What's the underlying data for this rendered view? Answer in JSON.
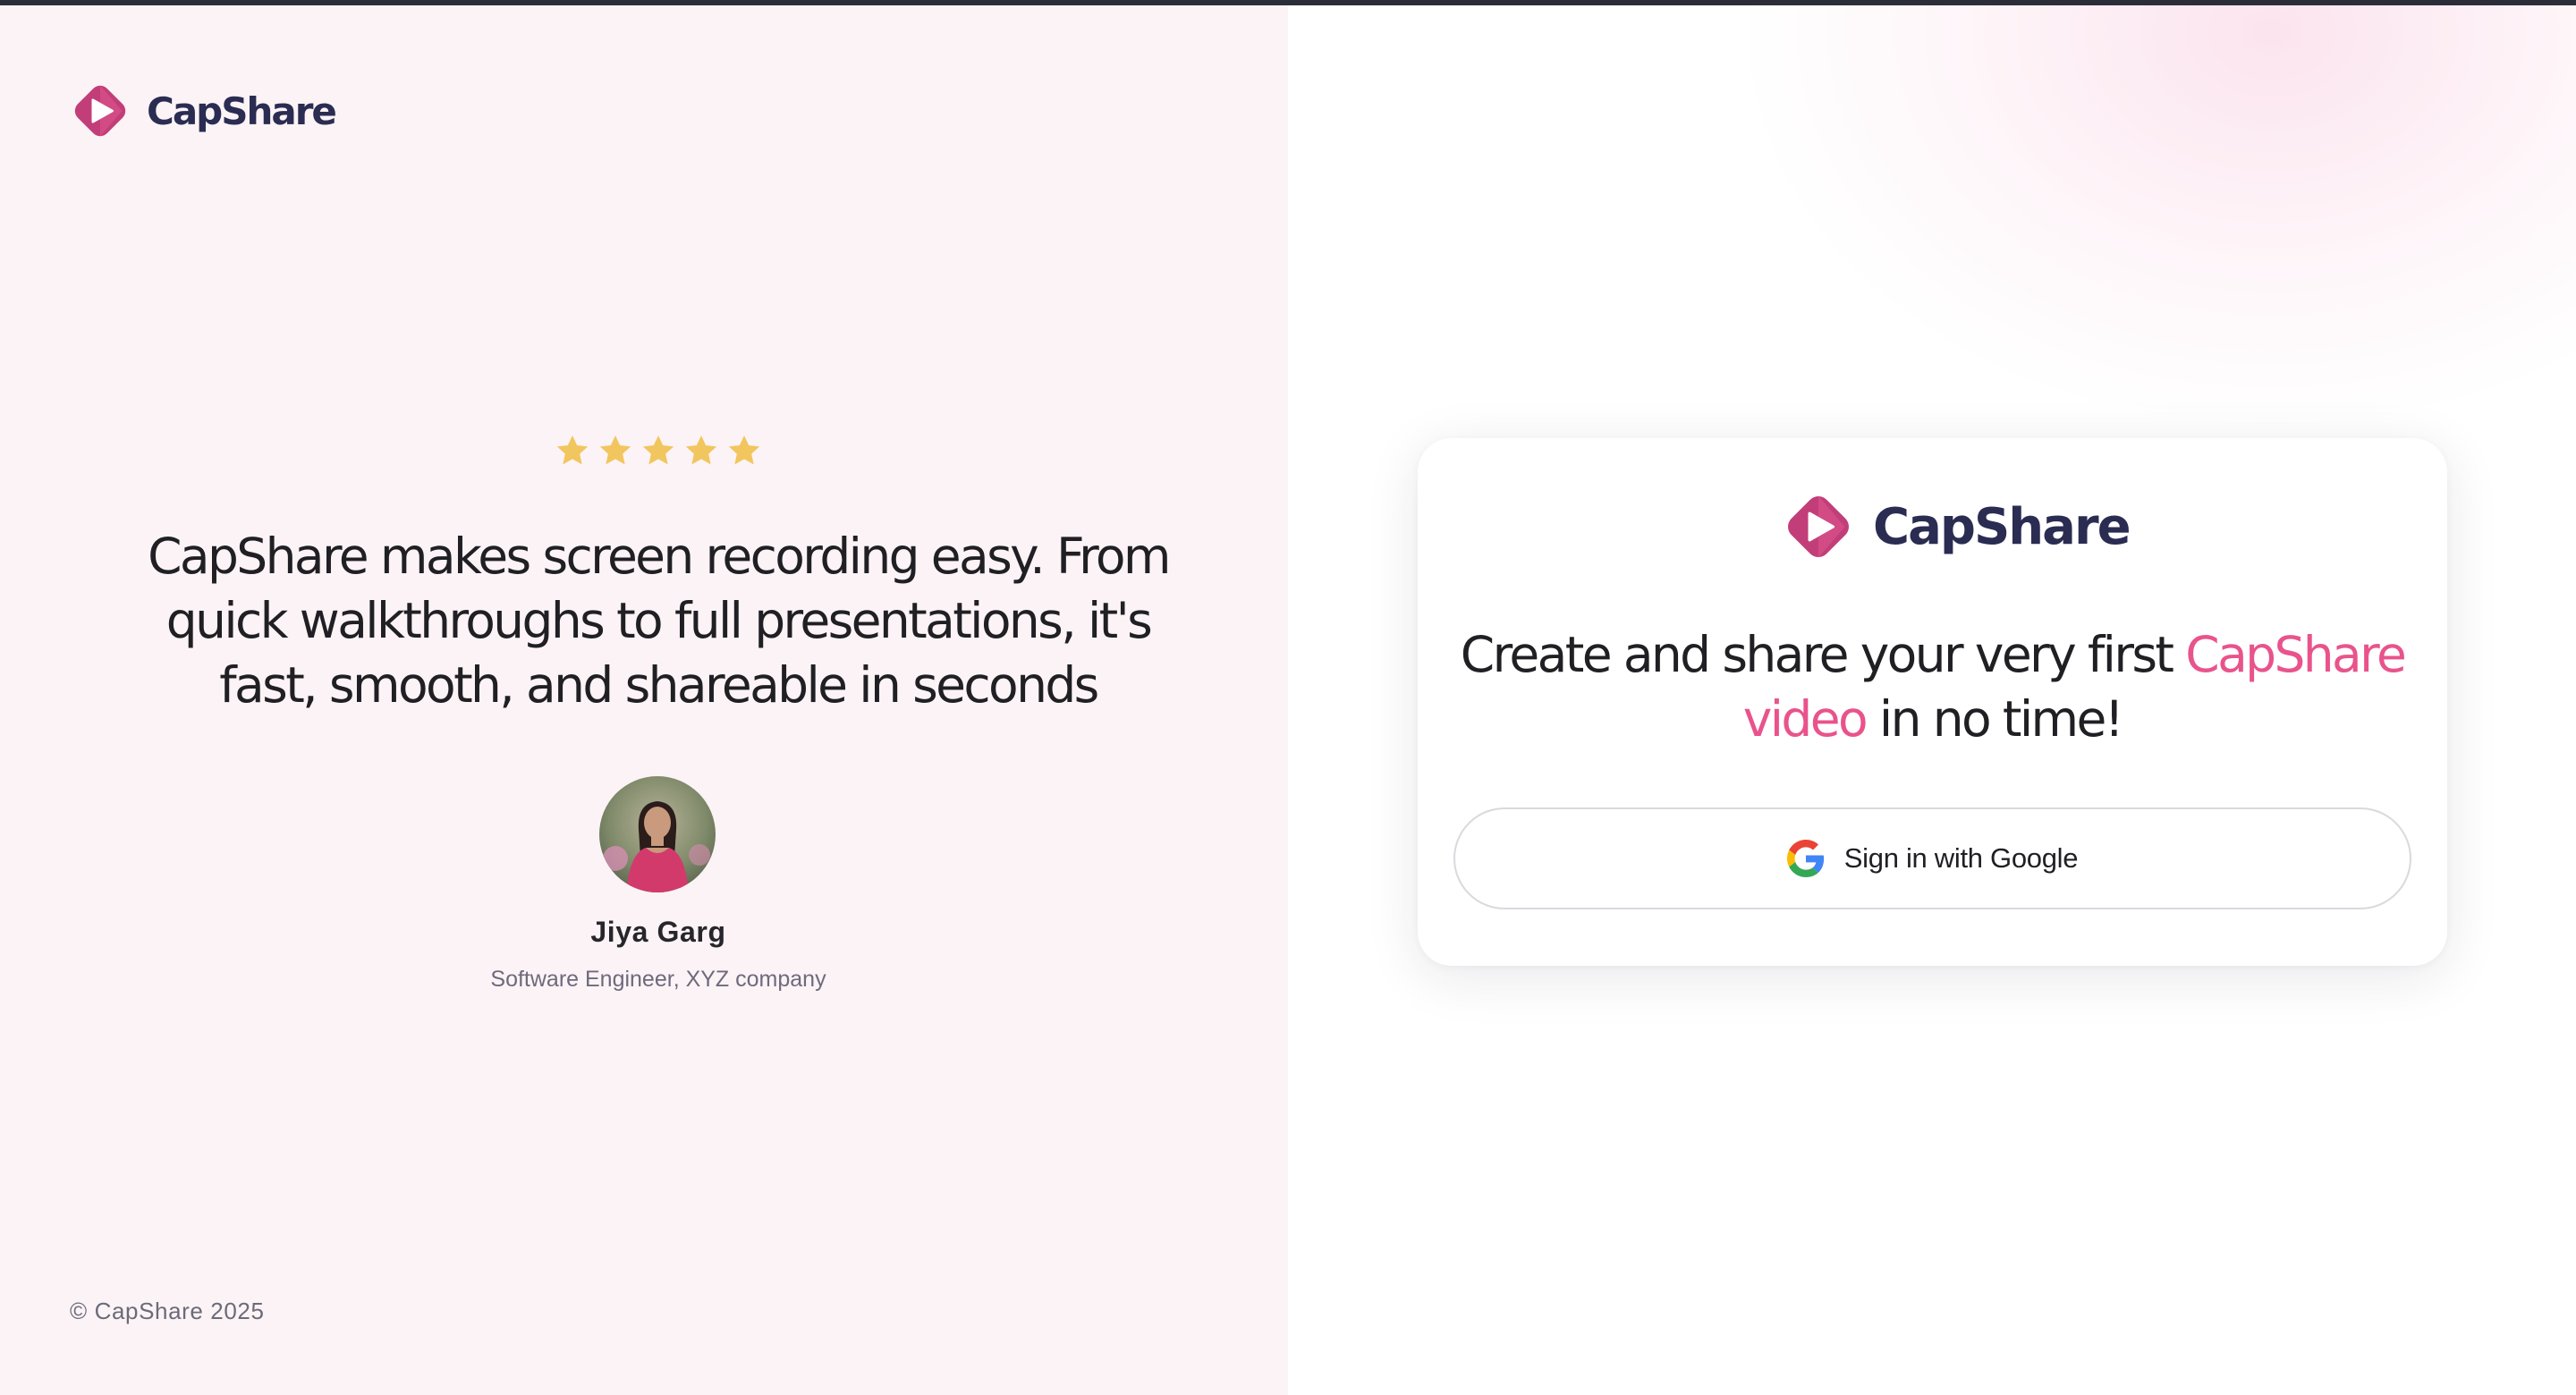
{
  "brand": {
    "name": "CapShare",
    "logo_icon": "capshare-play-logo",
    "colors": {
      "accent_pink": "#e9538b",
      "logo_dark_pink": "#c23e79",
      "brand_navy": "#2a2c52",
      "star_gold": "#f2c65e"
    }
  },
  "testimonial": {
    "rating": 5,
    "rating_max": 5,
    "quote": "CapShare makes screen recording easy. From quick walkthroughs to full presentations, it's fast, smooth, and shareable in seconds",
    "author_name": "Jiya Garg",
    "author_role": "Software Engineer, XYZ company",
    "avatar_icon": "user-avatar-photo"
  },
  "footer": {
    "copyright": "© CapShare 2025"
  },
  "card": {
    "headline_before": "Create and share your very first ",
    "headline_accent": "CapShare video",
    "headline_after": " in no time!",
    "google_button_label": "Sign in with Google",
    "google_icon": "google-g-icon"
  }
}
